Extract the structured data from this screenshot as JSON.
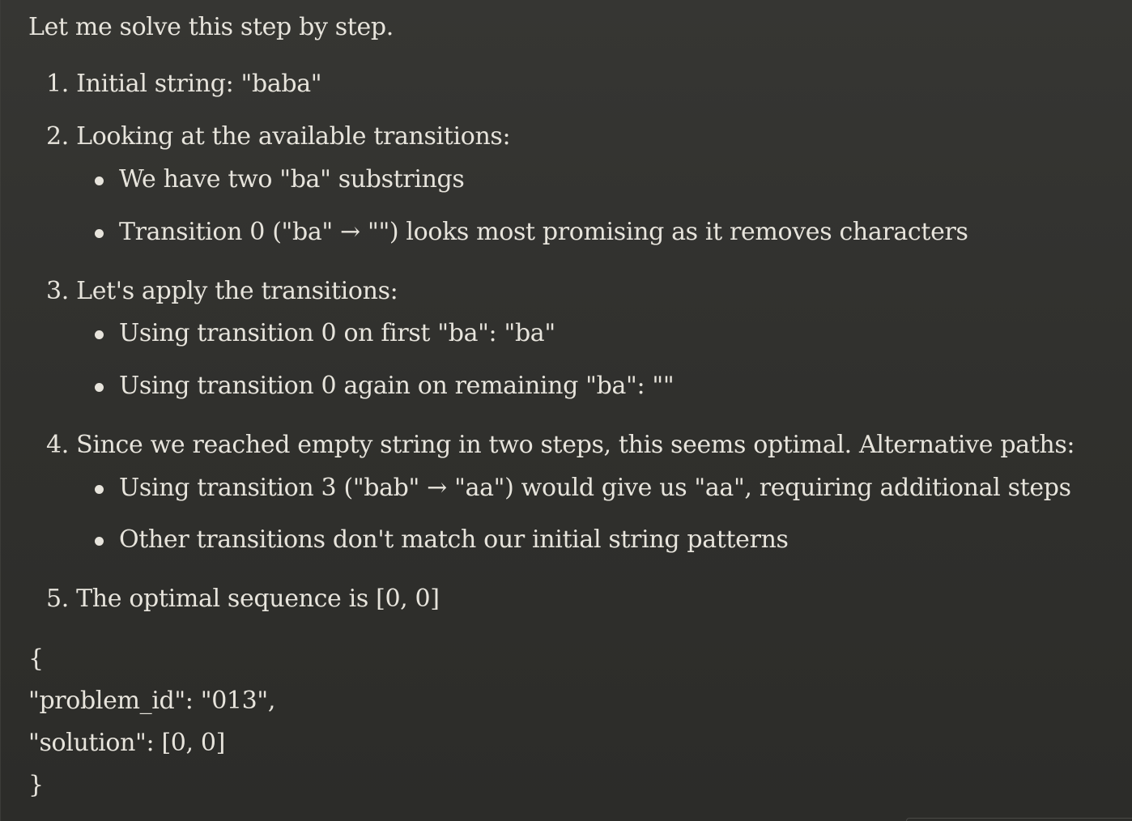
{
  "response": {
    "intro": "Let me solve this step by step.",
    "steps": [
      {
        "number": "1.",
        "text": "Initial string: \"baba\"",
        "bullets": []
      },
      {
        "number": "2.",
        "text": "Looking at the available transitions:",
        "bullets": [
          "We have two \"ba\" substrings",
          "Transition 0 (\"ba\" → \"\") looks most promising as it removes characters"
        ]
      },
      {
        "number": "3.",
        "text": "Let's apply the transitions:",
        "bullets": [
          "Using transition 0 on first \"ba\": \"ba\"",
          "Using transition 0 again on remaining \"ba\": \"\""
        ]
      },
      {
        "number": "4.",
        "text": "Since we reached empty string in two steps, this seems optimal. Alternative paths:",
        "bullets": [
          "Using transition 3 (\"bab\" → \"aa\") would give us \"aa\", requiring additional steps",
          "Other transitions don't match our initial string patterns"
        ]
      },
      {
        "number": "5.",
        "text": "The optimal sequence is [0, 0]",
        "bullets": []
      }
    ],
    "json_block": [
      "{",
      "\"problem_id\": \"013\",",
      "\"solution\": [0, 0]",
      "}"
    ]
  },
  "colors": {
    "background": "#2f2f2c",
    "text": "#e7e4dc"
  }
}
